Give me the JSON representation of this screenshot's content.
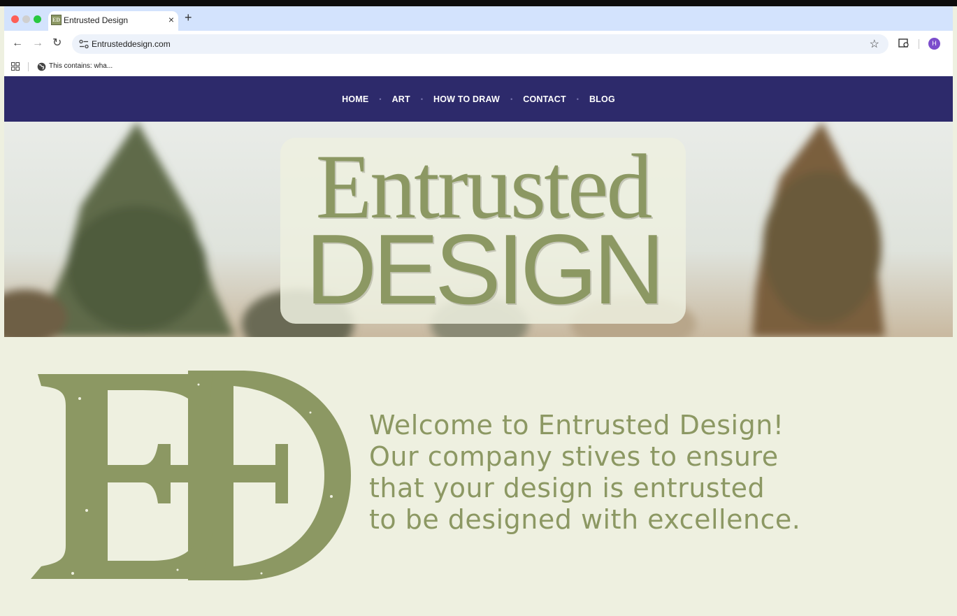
{
  "browser": {
    "tab_title": "Entrusted Design",
    "tab_favicon_text": "ED",
    "tab_close": "×",
    "new_tab": "+",
    "url": "Entrusteddesign.com",
    "bookmark_label": "This contains: wha...",
    "avatar_initial": "H",
    "icons": [
      "back-icon",
      "forward-icon",
      "reload-icon",
      "site-info-icon",
      "star-icon",
      "reading-list-icon",
      "apps-icon",
      "globe-icon"
    ]
  },
  "nav": {
    "items": [
      "HOME",
      "ART",
      "HOW TO DRAW",
      "CONTACT",
      "BLOG"
    ],
    "separator": "•"
  },
  "hero": {
    "logo_line1": "Entrusted",
    "logo_line2": "DESIGN"
  },
  "welcome": {
    "lines": [
      "Welcome to Entrusted Design!",
      "Our company stives to ensure",
      "that your design is entrusted",
      "to be designed with excellence."
    ]
  },
  "colors": {
    "nav_bg": "#2d2a6b",
    "brand_green": "#8c9863",
    "cream": "#eef0e0"
  }
}
